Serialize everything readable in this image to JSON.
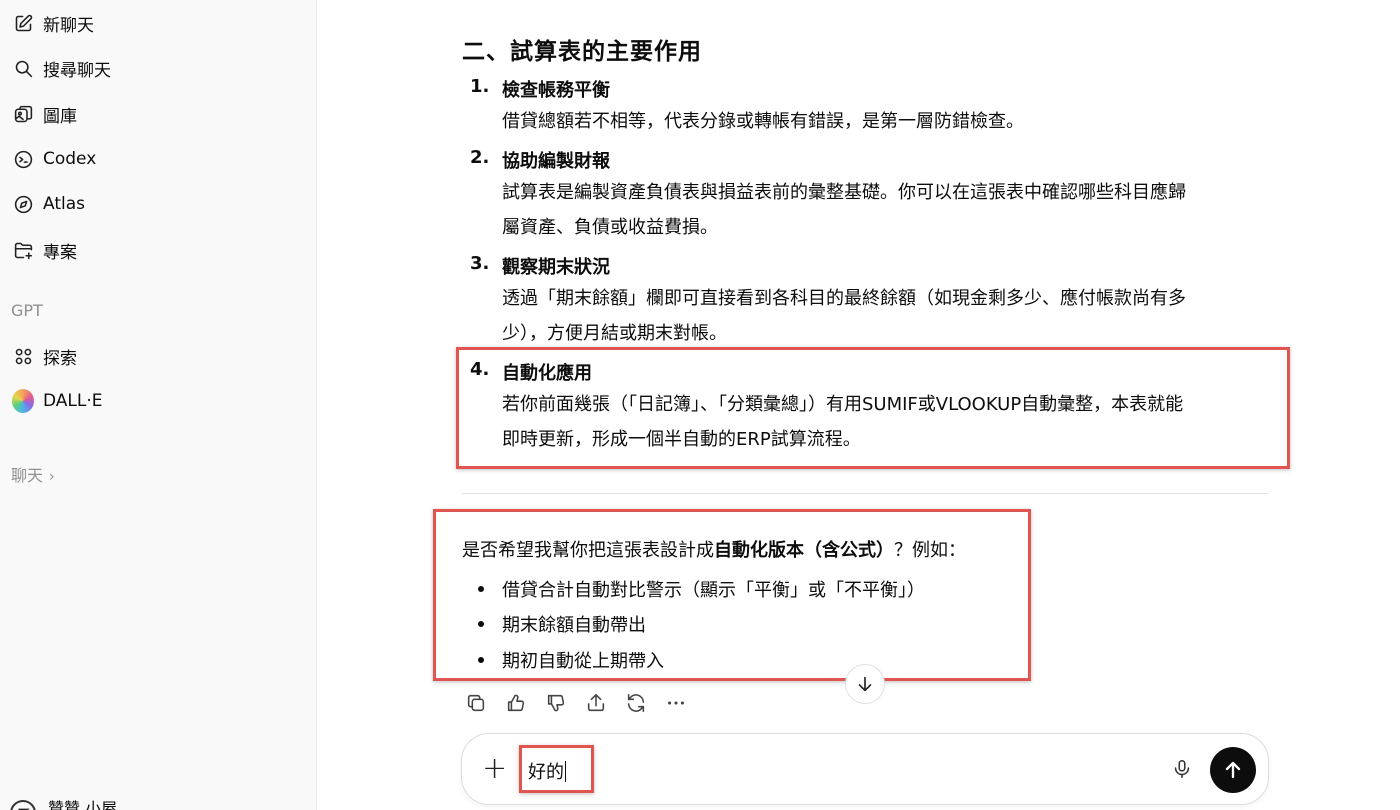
{
  "sidebar": {
    "items": [
      {
        "label": "新聊天",
        "icon": "edit-icon"
      },
      {
        "label": "搜尋聊天",
        "icon": "search-icon"
      },
      {
        "label": "圖庫",
        "icon": "image-gallery-icon"
      },
      {
        "label": "Codex",
        "icon": "codex-icon"
      },
      {
        "label": "Atlas",
        "icon": "compass-icon"
      },
      {
        "label": "專案",
        "icon": "folder-plus-icon"
      }
    ],
    "gpt_section": "GPT",
    "gpt_items": [
      {
        "label": "探索",
        "icon": "grid-icon"
      },
      {
        "label": "DALL·E",
        "icon": "dalle-avatar"
      }
    ],
    "chats_section": "聊天",
    "user_name": "贊贊 小屋"
  },
  "message": {
    "heading": "二、試算表的主要作用",
    "list": [
      {
        "num": "1.",
        "title": "檢查帳務平衡",
        "lines": [
          "借貸總額若不相等，代表分錄或轉帳有錯誤，是第一層防錯檢查。"
        ]
      },
      {
        "num": "2.",
        "title": "協助編製財報",
        "lines": [
          "試算表是編製資產負債表與損益表前的彙整基礎。你可以在這張表中確認哪些科目應歸",
          "屬資產、負債或收益費損。"
        ]
      },
      {
        "num": "3.",
        "title": "觀察期末狀況",
        "lines": [
          "透過「期末餘額」欄即可直接看到各科目的最終餘額（如現金剩多少、應付帳款尚有多",
          "少），方便月結或期末對帳。"
        ]
      },
      {
        "num": "4.",
        "title": "自動化應用",
        "lines": [
          "若你前面幾張（「日記簿」、「分類彙總」）有用SUMIF或VLOOKUP自動彙整，本表就能",
          "即時更新，形成一個半自動的ERP試算流程。"
        ]
      }
    ],
    "question_prefix": "是否希望我幫你把這張表設計成",
    "question_bold": "自動化版本（含公式）",
    "question_suffix": "？例如：",
    "bullets": [
      "借貸合計自動對比警示（顯示「平衡」或「不平衡」）",
      "期末餘額自動帶出",
      "期初自動從上期帶入"
    ]
  },
  "composer": {
    "value": "好的"
  },
  "colors": {
    "annotation": "#e0554f",
    "send_button": "#0d0d0d",
    "sidebar_bg": "#f9f9f9"
  }
}
